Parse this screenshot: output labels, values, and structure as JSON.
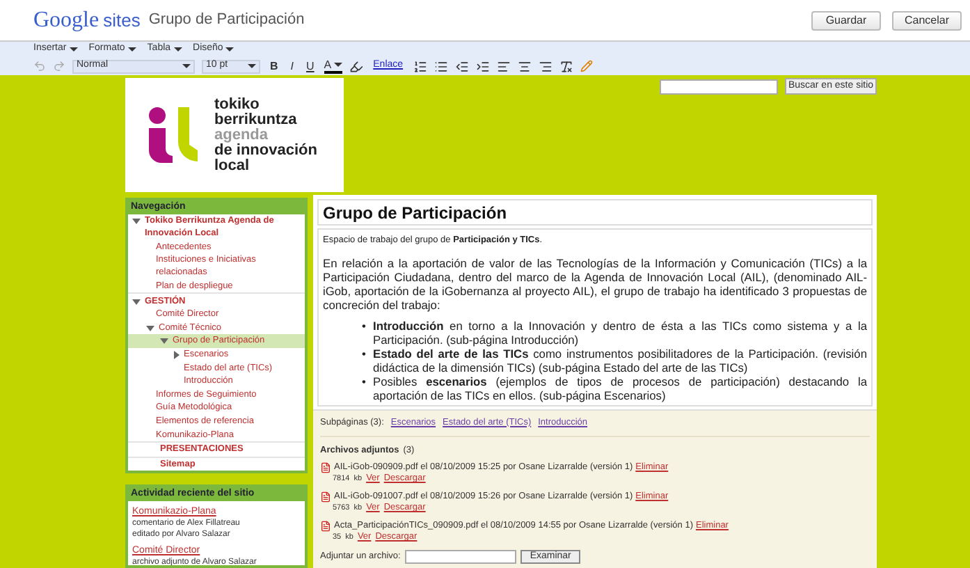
{
  "header": {
    "logo_brand": "Google",
    "logo_product": "sites",
    "page_title": "Grupo de Participación",
    "buttons": [
      "Guardar",
      "Cancelar"
    ]
  },
  "menus": [
    "Insertar",
    "Formato",
    "Tabla",
    "Diseño"
  ],
  "toolbar": {
    "style": "Normal",
    "size": "10 pt",
    "bold": "B",
    "italic": "I",
    "underline": "U",
    "font_color_label": "A",
    "link": "Enlace"
  },
  "site_logo": {
    "lines": [
      {
        "text": "tokiko",
        "kind": "dark"
      },
      {
        "text": "berrikuntza",
        "kind": "dark"
      },
      {
        "text": "agenda",
        "kind": "grey"
      },
      {
        "text": "de innovación",
        "kind": "dark"
      },
      {
        "text": "local",
        "kind": "dark"
      }
    ]
  },
  "search": {
    "button": "Buscar en este sitio"
  },
  "navigation": {
    "title": "Navegación",
    "items": [
      {
        "label": "Tokiko Berrikuntza Agenda de Innovación Local",
        "expanded": true,
        "selected": false,
        "children": [
          {
            "label": "Antecedentes",
            "selected": false
          },
          {
            "label": "Instituciones e Iniciativas relacionadas",
            "selected": false
          },
          {
            "label": "Plan de despliegue",
            "selected": false
          }
        ]
      },
      {
        "label": "GESTIÓN",
        "expanded": true,
        "selected": false,
        "children": [
          {
            "label": "Comité Director",
            "selected": false
          },
          {
            "label": "Comité Técnico",
            "expanded": true,
            "selected": false,
            "children": [
              {
                "label": "Grupo de Participación",
                "expanded": true,
                "selected": true,
                "children": [
                  {
                    "label": "Escenarios",
                    "expanded": false,
                    "selected": false
                  },
                  {
                    "label": "Estado del arte (TICs)",
                    "selected": false
                  },
                  {
                    "label": "Introducción",
                    "selected": false
                  }
                ]
              }
            ]
          },
          {
            "label": "Informes de Seguimiento",
            "selected": false
          },
          {
            "label": "Guía Metodológica",
            "selected": false
          },
          {
            "label": "Elementos de referencia",
            "selected": false
          },
          {
            "label": "Komunikazio-Plana",
            "selected": false
          }
        ]
      },
      {
        "label": "PRESENTACIONES",
        "selected": false
      },
      {
        "label": "Sitemap",
        "selected": false
      }
    ]
  },
  "activity": {
    "title": "Actividad reciente del sitio",
    "items": [
      {
        "page": "Komunikazio-Plana",
        "lines": [
          "comentario de Alex Fillatreau",
          "editado por Alvaro Salazar"
        ]
      },
      {
        "page": "Comité Director",
        "lines": [
          "archivo adjunto de Alvaro Salazar"
        ]
      }
    ]
  },
  "page": {
    "title": "Grupo de Participación",
    "intro": "Espacio de trabajo del grupo de **Participación y TICs**.",
    "paragraph": "En relación a la aportación de valor de las Tecnologías de la Información y Comunicación (TICs) a la Participación Ciudadana, dentro del marco de la Agenda de Innovación Local (AIL), (denominado AIL-iGob,  aportación de la iGobernanza al proyecto AIL), el grupo de trabajo ha identificado 3 propuestas de concreción del trabajo:",
    "bullet_marker": "•",
    "bullets": [
      "**Introducción** en torno a la Innovación y dentro de ésta a las TICs como sistema y a la Participación.  (sub-página Introducción)",
      "**Estado del arte de las TICs** como instrumentos posibilitadores de la Participación. (revisión didáctica de la dimensión TICs)  (sub-página Estado del arte de las TICs)",
      "Posibles **escenarios** (ejemplos de tipos de procesos de participación) destacando la aportación de las TICs en ellos. (sub-página Escenarios)"
    ]
  },
  "subpages": {
    "label": "Subpáginas (3):",
    "links": [
      "Escenarios",
      "Estado del arte (TICs)",
      "Introducción"
    ]
  },
  "attachments": {
    "title": "Archivos adjuntos",
    "count": "(3)",
    "files": [
      {
        "name": "AIL-iGob-090909.pdf",
        "meta": "el 08/10/2009 15:25 por Osane Lizarralde (versión 1)",
        "delete": "Eliminar",
        "size": "7814",
        "unit": "kb",
        "view": "Ver",
        "download": "Descargar"
      },
      {
        "name": "AIL-iGob-091007.pdf",
        "meta": "el 08/10/2009 15:26 por Osane Lizarralde (versión 1)",
        "delete": "Eliminar",
        "size": "5763",
        "unit": "kb",
        "view": "Ver",
        "download": "Descargar"
      },
      {
        "name": "Acta_ParticipaciónTICs_090909.pdf",
        "meta": "el 08/10/2009 14:55 por Osane Lizarralde (versión 1)",
        "delete": "Eliminar",
        "size": "35",
        "unit": "kb",
        "view": "Ver",
        "download": "Descargar"
      }
    ],
    "upload_label": "Adjuntar un archivo:",
    "browse": "Examinar"
  }
}
